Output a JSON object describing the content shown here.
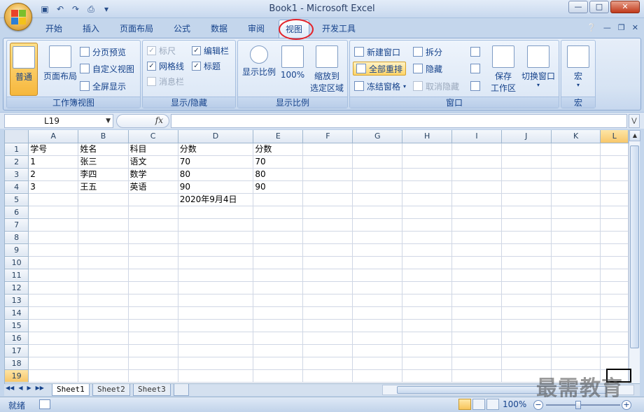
{
  "window": {
    "title": "Book1 - Microsoft Excel"
  },
  "tabs": [
    {
      "label": "开始"
    },
    {
      "label": "插入"
    },
    {
      "label": "页面布局"
    },
    {
      "label": "公式"
    },
    {
      "label": "数据"
    },
    {
      "label": "审阅"
    },
    {
      "label": "视图"
    },
    {
      "label": "开发工具"
    }
  ],
  "ribbon": {
    "workbook_views": {
      "label": "工作簿视图",
      "normal": "普通",
      "page_layout": "页面布局",
      "page_break": "分页预览",
      "custom_views": "自定义视图",
      "full_screen": "全屏显示"
    },
    "show_hide": {
      "label": "显示/隐藏",
      "ruler": "标尺",
      "formula_bar": "编辑栏",
      "gridlines": "网格线",
      "headings": "标题",
      "message_bar": "消息栏"
    },
    "zoom": {
      "label": "显示比例",
      "zoom": "显示比例",
      "pct100": "100%",
      "zoom_sel1": "缩放到",
      "zoom_sel2": "选定区域"
    },
    "window": {
      "label": "窗口",
      "new_window": "新建窗口",
      "arrange_all": "全部重排",
      "freeze": "冻结窗格",
      "split": "拆分",
      "hide": "隐藏",
      "unhide": "取消隐藏",
      "save_ws1": "保存",
      "save_ws2": "工作区",
      "switch": "切换窗口"
    },
    "macros": {
      "label": "宏",
      "macros": "宏"
    }
  },
  "formula_bar": {
    "name_box": "L19",
    "fx": "fx",
    "value": ""
  },
  "grid": {
    "columns": [
      "A",
      "B",
      "C",
      "D",
      "E",
      "F",
      "G",
      "H",
      "I",
      "J",
      "K"
    ],
    "selected_column": "L",
    "rows": [
      {
        "n": "1",
        "cells": [
          "学号",
          "姓名",
          "科目",
          "分数",
          "分数",
          "",
          "",
          "",
          "",
          "",
          ""
        ]
      },
      {
        "n": "2",
        "cells": [
          "1",
          "张三",
          "语文",
          "70",
          "70",
          "",
          "",
          "",
          "",
          "",
          ""
        ]
      },
      {
        "n": "3",
        "cells": [
          "2",
          "李四",
          "数学",
          "80",
          "80",
          "",
          "",
          "",
          "",
          "",
          ""
        ]
      },
      {
        "n": "4",
        "cells": [
          "3",
          "王五",
          "英语",
          "90",
          "90",
          "",
          "",
          "",
          "",
          "",
          ""
        ]
      },
      {
        "n": "5",
        "cells": [
          "",
          "",
          "",
          "2020年9月4日",
          "",
          "",
          "",
          "",
          "",
          "",
          ""
        ]
      },
      {
        "n": "6",
        "cells": []
      },
      {
        "n": "7",
        "cells": []
      },
      {
        "n": "8",
        "cells": []
      },
      {
        "n": "9",
        "cells": []
      },
      {
        "n": "10",
        "cells": []
      },
      {
        "n": "11",
        "cells": []
      },
      {
        "n": "12",
        "cells": []
      },
      {
        "n": "13",
        "cells": []
      },
      {
        "n": "14",
        "cells": []
      },
      {
        "n": "15",
        "cells": []
      },
      {
        "n": "16",
        "cells": []
      },
      {
        "n": "17",
        "cells": []
      },
      {
        "n": "18",
        "cells": []
      },
      {
        "n": "19",
        "cells": []
      }
    ]
  },
  "sheets": [
    "Sheet1",
    "Sheet2",
    "Sheet3"
  ],
  "status": {
    "ready": "就绪",
    "zoom": "100%"
  },
  "watermark": "最需教育"
}
